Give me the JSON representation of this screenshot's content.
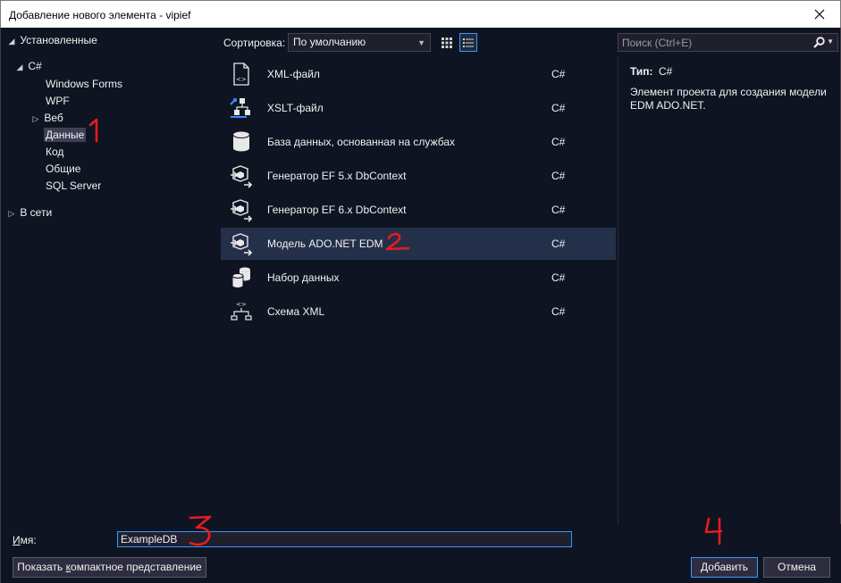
{
  "window": {
    "title": "Добавление нового элемента  - vipief"
  },
  "tree": {
    "installed": "Установленные",
    "csharp": "C#",
    "items": [
      {
        "label": "Windows Forms"
      },
      {
        "label": "WPF"
      },
      {
        "label": "Веб"
      },
      {
        "label": "Данные"
      },
      {
        "label": "Код"
      },
      {
        "label": "Общие"
      },
      {
        "label": "SQL Server"
      }
    ],
    "online": "В сети"
  },
  "toolbar": {
    "sort_label": "Сортировка:",
    "sort_value": "По умолчанию"
  },
  "search": {
    "placeholder": "Поиск (Ctrl+E)"
  },
  "templates": [
    {
      "name": "XML-файл",
      "lang": "C#",
      "icon": "xml-file-icon"
    },
    {
      "name": "XSLT-файл",
      "lang": "C#",
      "icon": "xslt-file-icon"
    },
    {
      "name": "База данных, основанная на службах",
      "lang": "C#",
      "icon": "database-icon"
    },
    {
      "name": "Генератор EF 5.x DbContext",
      "lang": "C#",
      "icon": "ef-generator-icon"
    },
    {
      "name": "Генератор EF 6.x DbContext",
      "lang": "C#",
      "icon": "ef-generator-icon"
    },
    {
      "name": "Модель ADO.NET EDM",
      "lang": "C#",
      "icon": "edm-model-icon"
    },
    {
      "name": "Набор данных",
      "lang": "C#",
      "icon": "dataset-icon"
    },
    {
      "name": "Схема XML",
      "lang": "C#",
      "icon": "xml-schema-icon"
    }
  ],
  "info": {
    "type_label": "Тип:",
    "type_value": "C#",
    "description": "Элемент проекта для создания модели EDM ADO.NET."
  },
  "bottom": {
    "name_label_underlined": "И",
    "name_label_rest": "мя:",
    "name_value": "ExampleDB",
    "compact_button_pre": "Показать ",
    "compact_button_underlined": "к",
    "compact_button_post": "омпактное представление",
    "add_button_underlined": "Д",
    "add_button_rest": "обавить",
    "cancel_button": "Отмена"
  },
  "colors": {
    "background": "#0f1422",
    "selection": "#243049",
    "accent": "#3399ff",
    "annotation": "#e81c1c"
  }
}
